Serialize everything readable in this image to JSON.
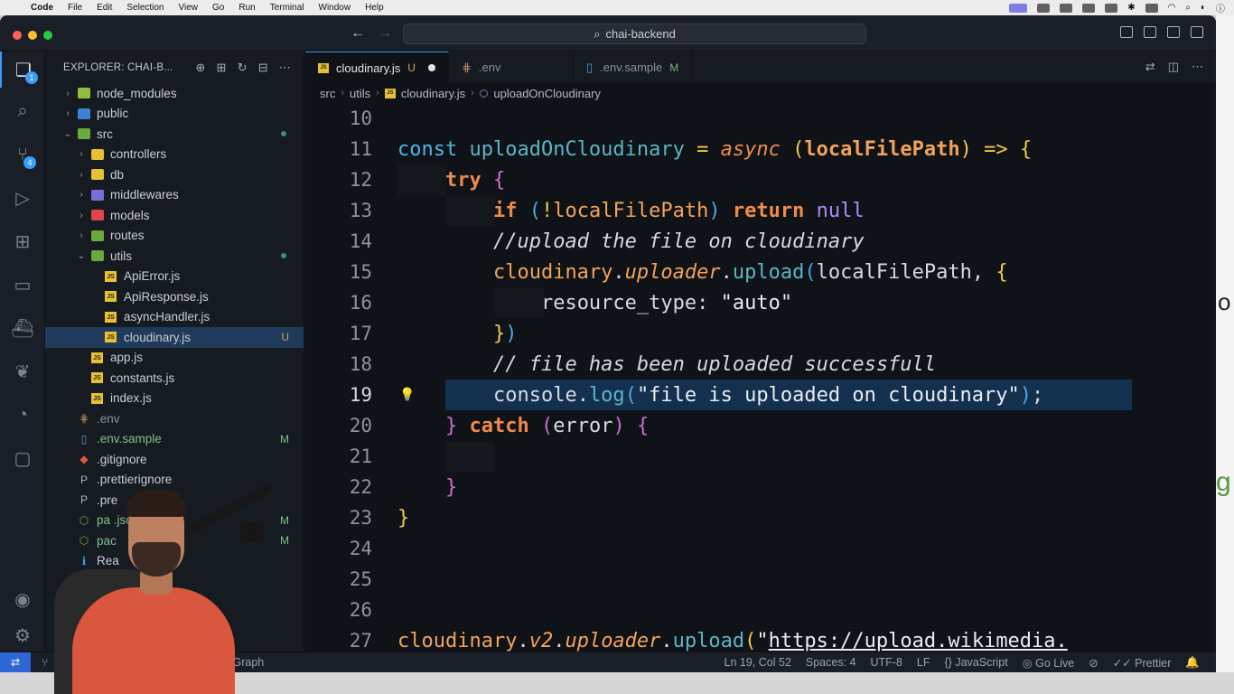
{
  "menubar": {
    "apple": "",
    "items": [
      "Code",
      "File",
      "Edit",
      "Selection",
      "View",
      "Go",
      "Run",
      "Terminal",
      "Window",
      "Help"
    ]
  },
  "titlebar": {
    "search": "chai-backend"
  },
  "activity": {
    "source_control_badge": "1",
    "extensions_badge": "4"
  },
  "explorer": {
    "header": "EXPLORER: CHAI-B...",
    "items": [
      {
        "label": "node_modules",
        "indent": 0,
        "kind": "folder",
        "color": "#8fbf3a",
        "chev": "›"
      },
      {
        "label": "public",
        "indent": 0,
        "kind": "folder",
        "color": "#3b82d6",
        "chev": "›"
      },
      {
        "label": "src",
        "indent": 0,
        "kind": "folder",
        "color": "#6aaa3c",
        "chev": "⌄",
        "dot": true
      },
      {
        "label": "controllers",
        "indent": 1,
        "kind": "folder",
        "color": "#e8c133",
        "chev": "›"
      },
      {
        "label": "db",
        "indent": 1,
        "kind": "folder",
        "color": "#e8c133",
        "chev": "›"
      },
      {
        "label": "middlewares",
        "indent": 1,
        "kind": "folder",
        "color": "#7a6fd6",
        "chev": "›"
      },
      {
        "label": "models",
        "indent": 1,
        "kind": "folder",
        "color": "#e0464c",
        "chev": "›"
      },
      {
        "label": "routes",
        "indent": 1,
        "kind": "folder",
        "color": "#6aaa3c",
        "chev": "›"
      },
      {
        "label": "utils",
        "indent": 1,
        "kind": "folder",
        "color": "#6aaa3c",
        "chev": "⌄",
        "dot": true
      },
      {
        "label": "ApiError.js",
        "indent": 2,
        "kind": "js"
      },
      {
        "label": "ApiResponse.js",
        "indent": 2,
        "kind": "js"
      },
      {
        "label": "asyncHandler.js",
        "indent": 2,
        "kind": "js"
      },
      {
        "label": "cloudinary.js",
        "indent": 2,
        "kind": "js",
        "status": "U",
        "selected": true
      },
      {
        "label": "app.js",
        "indent": 1,
        "kind": "js"
      },
      {
        "label": "constants.js",
        "indent": 1,
        "kind": "js"
      },
      {
        "label": "index.js",
        "indent": 1,
        "kind": "js"
      },
      {
        "label": ".env",
        "indent": 0,
        "kind": "glyph",
        "glyph": "⋕",
        "color": "#b58a5a",
        "muted": true
      },
      {
        "label": ".env.sample",
        "indent": 0,
        "kind": "glyph",
        "glyph": "▯",
        "color": "#5a9bd6",
        "status": "M",
        "green": true
      },
      {
        "label": ".gitignore",
        "indent": 0,
        "kind": "glyph",
        "glyph": "◆",
        "color": "#e0563c"
      },
      {
        "label": ".prettierignore",
        "indent": 0,
        "kind": "glyph",
        "glyph": "P",
        "color": "#b0b6c0"
      },
      {
        "label": ".pre",
        "indent": 0,
        "kind": "glyph",
        "glyph": "P",
        "color": "#b0b6c0"
      },
      {
        "label": "pa          .json",
        "indent": 0,
        "kind": "glyph",
        "glyph": "⬡",
        "color": "#6aaa3c",
        "status": "M",
        "green": true
      },
      {
        "label": "pac",
        "indent": 0,
        "kind": "glyph",
        "glyph": "⬡",
        "color": "#6aaa3c",
        "status": "M",
        "green": true
      },
      {
        "label": "Rea",
        "indent": 0,
        "kind": "glyph",
        "glyph": "ℹ",
        "color": "#3b9cff"
      }
    ]
  },
  "tabs": [
    {
      "label": "cloudinary.js",
      "status": "U",
      "active": true,
      "unsaved": true,
      "kind": "js"
    },
    {
      "label": ".env",
      "kind": "env"
    },
    {
      "label": ".env.sample",
      "status": "M",
      "kind": "doc"
    }
  ],
  "breadcrumb": [
    "src",
    "utils",
    "cloudinary.js",
    "uploadOnCloudinary"
  ],
  "code": {
    "line_numbers": [
      "10",
      "11",
      "12",
      "13",
      "14",
      "15",
      "16",
      "17",
      "18",
      "19",
      "20",
      "21",
      "22",
      "23",
      "24",
      "25",
      "26",
      "27"
    ],
    "current_line": "19"
  },
  "statusbar": {
    "branch_fragment": "Graph",
    "position": "Ln 19, Col 52",
    "spaces": "Spaces: 4",
    "encoding": "UTF-8",
    "eol": "LF",
    "language": "JavaScript",
    "golive": "Go Live",
    "prettier": "Prettier"
  },
  "colors": {
    "accent": "#3b9cff",
    "editor_bg": "#0f1216",
    "line_highlight": "#14304f"
  }
}
